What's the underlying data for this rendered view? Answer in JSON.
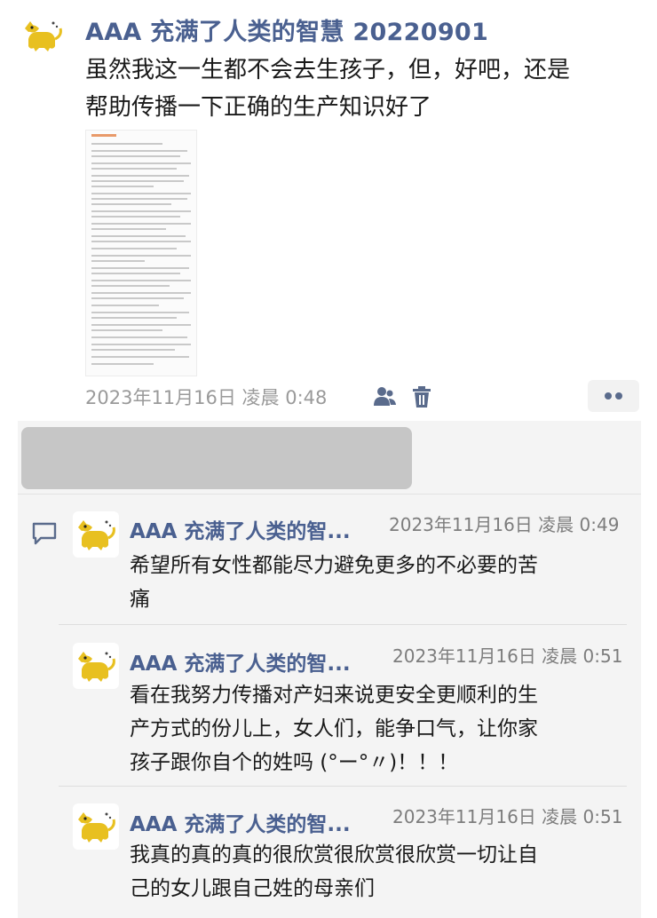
{
  "post": {
    "author": "AAA 充满了人类的智慧 20220901",
    "text_line1": "虽然我这一生都不会去生孩子，但，好吧，还是",
    "text_line2": "帮助传播一下正确的生产知识好了",
    "timestamp": "2023年11月16日 凌晨 0:48",
    "icons": [
      "cat-avatar",
      "visibility-people-icon",
      "trash-icon",
      "more-dots-icon"
    ]
  },
  "comments": [
    {
      "author": "AAA 充满了人类的智...",
      "time": "2023年11月16日 凌晨 0:49",
      "line1": "希望所有女性都能尽力避免更多的不必要的苦",
      "line2": "痛"
    },
    {
      "author": "AAA 充满了人类的智...",
      "time": "2023年11月16日 凌晨 0:51",
      "line1": "看在我努力传播对产妇来说更安全更顺利的生",
      "line2": "产方式的份儿上，女人们，能争口气，让你家",
      "line3": "孩子跟你自个的姓吗 (°ー°〃)！！！"
    },
    {
      "author": "AAA 充满了人类的智...",
      "time": "2023年11月16日 凌晨 0:51",
      "line1": "我真的真的真的很欣赏很欣赏很欣赏一切让自",
      "line2": "己的女儿跟自己姓的母亲们"
    }
  ],
  "colors": {
    "name_blue": "#4a6090",
    "panel_bg": "#f4f4f4",
    "likes_redacted": "#c6c6c6"
  }
}
